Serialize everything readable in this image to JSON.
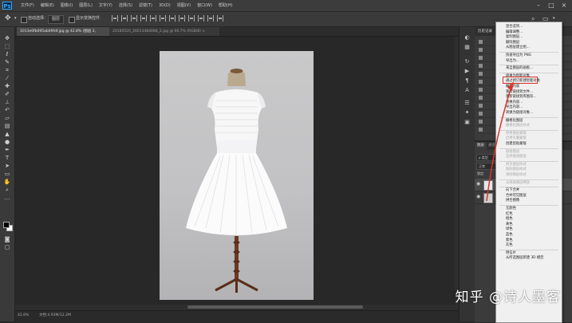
{
  "app": {
    "logo": "Ps"
  },
  "menubar": {
    "items": [
      "文件(F)",
      "编辑(E)",
      "图像(I)",
      "图层(L)",
      "文字(Y)",
      "选择(S)",
      "滤镜(T)",
      "3D(D)",
      "视图(V)",
      "窗口(W)",
      "帮助(H)"
    ],
    "win_minimize": "–",
    "win_maximize": "□",
    "win_close": "×"
  },
  "options": {
    "auto_select_label": "自动选择：",
    "auto_select_value": "图层",
    "show_transform_label": "显示变换控件"
  },
  "tabs": [
    {
      "label": "1013e0fb095ab09fdf.jpg @ 42.8% (图层 2, RGB/8) *  ×"
    },
    {
      "label": "20160520_26013484088_2.jpg @ 66.7% (RGB/8)  ×"
    }
  ],
  "status": {
    "zoom": "42.8%",
    "doc": "文档:4.93M/12.2M"
  },
  "panels": {
    "top_tab": "历史记录",
    "layers_tabs": [
      "图层",
      "通道",
      "路径"
    ],
    "kind_label": "ρ 类型",
    "blend_mode": "正常",
    "lock_label": "锁定:"
  },
  "context_menu": {
    "items": [
      {
        "label": "混合选项...",
        "enabled": true
      },
      {
        "label": "编辑调整...",
        "enabled": true
      },
      {
        "label": "复制图层...",
        "enabled": true
      },
      {
        "label": "删除图层",
        "enabled": true
      },
      {
        "label": "从图层建立组...",
        "enabled": true
      },
      {
        "sep": true
      },
      {
        "label": "快速导出为 PNG",
        "enabled": true
      },
      {
        "label": "导出为...",
        "enabled": true
      },
      {
        "sep": true
      },
      {
        "label": "来自图层的画板...",
        "enabled": true
      },
      {
        "sep": true
      },
      {
        "label": "转换为智能对象",
        "enabled": true,
        "highlight": true
      },
      {
        "label": "通过拷贝新建智能对象",
        "enabled": true
      },
      {
        "label": "编辑内容",
        "enabled": true
      },
      {
        "label": "重新链接到文件...",
        "enabled": true
      },
      {
        "label": "重新链接到库图形...",
        "enabled": true
      },
      {
        "label": "替换内容...",
        "enabled": true
      },
      {
        "label": "导出内容...",
        "enabled": true
      },
      {
        "label": "转换为链接对象...",
        "enabled": true
      },
      {
        "sep": true
      },
      {
        "label": "栅格化图层",
        "enabled": true
      },
      {
        "label": "栅格化图层样式",
        "enabled": false
      },
      {
        "sep": true
      },
      {
        "label": "停用图层蒙版",
        "enabled": false
      },
      {
        "label": "启用矢量蒙版",
        "enabled": false
      },
      {
        "label": "创建剪贴蒙版",
        "enabled": true
      },
      {
        "sep": true
      },
      {
        "label": "链接图层",
        "enabled": false
      },
      {
        "label": "选择链接图层",
        "enabled": false
      },
      {
        "sep": true
      },
      {
        "label": "拷贝图层样式",
        "enabled": false
      },
      {
        "label": "粘贴图层样式",
        "enabled": false
      },
      {
        "label": "清除图层样式",
        "enabled": false
      },
      {
        "sep": true
      },
      {
        "label": "从隔离图层释放",
        "enabled": false
      },
      {
        "sep": true
      },
      {
        "label": "向下合并",
        "enabled": true
      },
      {
        "label": "合并可见图层",
        "enabled": true
      },
      {
        "label": "拼合图像",
        "enabled": true
      },
      {
        "sep": true
      },
      {
        "label": "无颜色",
        "enabled": true
      },
      {
        "label": "红色",
        "enabled": true
      },
      {
        "label": "橙色",
        "enabled": true
      },
      {
        "label": "黄色",
        "enabled": true
      },
      {
        "label": "绿色",
        "enabled": true
      },
      {
        "label": "蓝色",
        "enabled": true
      },
      {
        "label": "紫色",
        "enabled": true
      },
      {
        "label": "灰色",
        "enabled": true
      },
      {
        "sep": true
      },
      {
        "label": "明信片",
        "enabled": true
      },
      {
        "label": "从所选图层新建 3D 模型",
        "enabled": true
      }
    ]
  },
  "watermark": "知乎 @诗人墨客",
  "colors": {
    "highlight_box": "#d9342b",
    "arrow": "#d9342b",
    "ps_blue": "#31a8ff"
  }
}
